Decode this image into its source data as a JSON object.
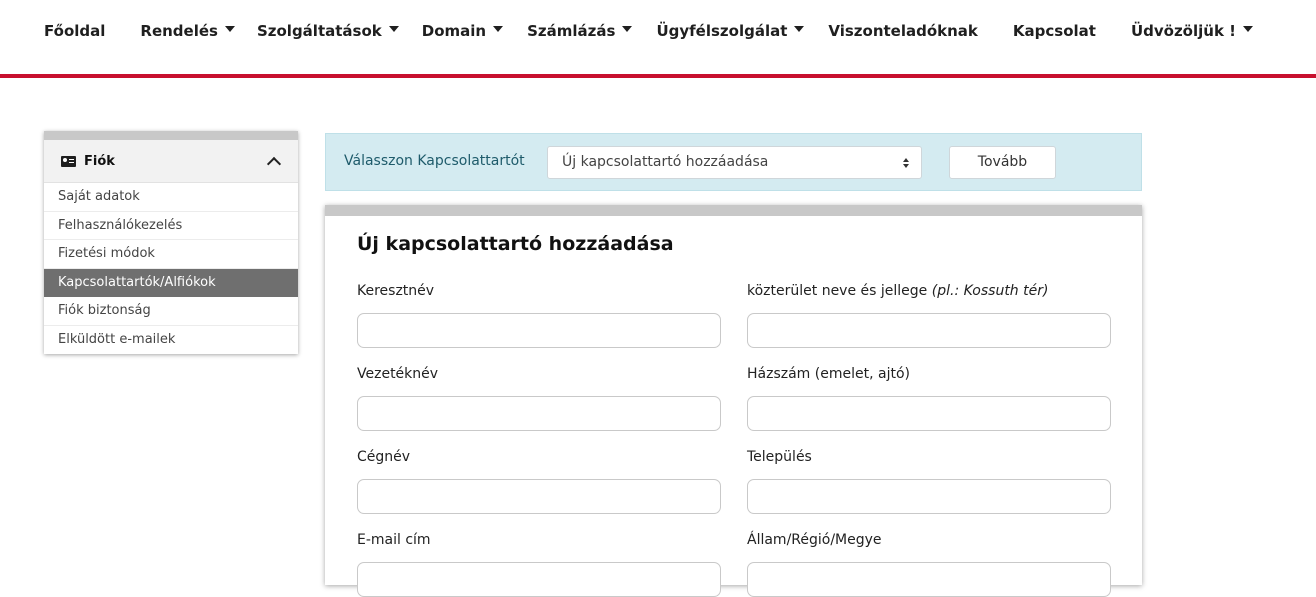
{
  "nav": {
    "items": [
      {
        "label": "Főoldal",
        "dropdown": false
      },
      {
        "label": "Rendelés",
        "dropdown": true
      },
      {
        "label": "Szolgáltatások",
        "dropdown": true
      },
      {
        "label": "Domain",
        "dropdown": true
      },
      {
        "label": "Számlázás",
        "dropdown": true
      },
      {
        "label": "Ügyfélszolgálat",
        "dropdown": true
      },
      {
        "label": "Viszonteladóknak",
        "dropdown": false
      },
      {
        "label": "Kapcsolat",
        "dropdown": false
      },
      {
        "label": "Üdvözöljük !",
        "dropdown": true
      }
    ],
    "accent_color": "#c8102e"
  },
  "sidebar": {
    "title": "Fiók",
    "icon": "id-card-icon",
    "items": [
      {
        "label": "Saját adatok"
      },
      {
        "label": "Felhasználókezelés"
      },
      {
        "label": "Fizetési módok"
      },
      {
        "label": "Kapcsolattartók/Alfiókok",
        "active": true
      },
      {
        "label": "Fiók biztonság"
      },
      {
        "label": "Elküldött e-mailek"
      }
    ]
  },
  "chooser": {
    "label": "Válasszon Kapcsolattartót",
    "selected": "Új kapcsolattartó hozzáadása",
    "button": "Tovább"
  },
  "form": {
    "title": "Új kapcsolattartó hozzáadása",
    "left_fields": [
      {
        "label": "Keresztnév",
        "value": ""
      },
      {
        "label": "Vezetéknév",
        "value": ""
      },
      {
        "label": "Cégnév",
        "value": ""
      },
      {
        "label": "E-mail cím",
        "value": ""
      }
    ],
    "right_fields": [
      {
        "label": "közterület neve és jellege",
        "hint": "(pl.: Kossuth tér)",
        "value": ""
      },
      {
        "label": "Házszám (emelet, ajtó)",
        "value": ""
      },
      {
        "label": "Település",
        "value": ""
      },
      {
        "label": "Állam/Régió/Megye",
        "value": ""
      }
    ]
  }
}
